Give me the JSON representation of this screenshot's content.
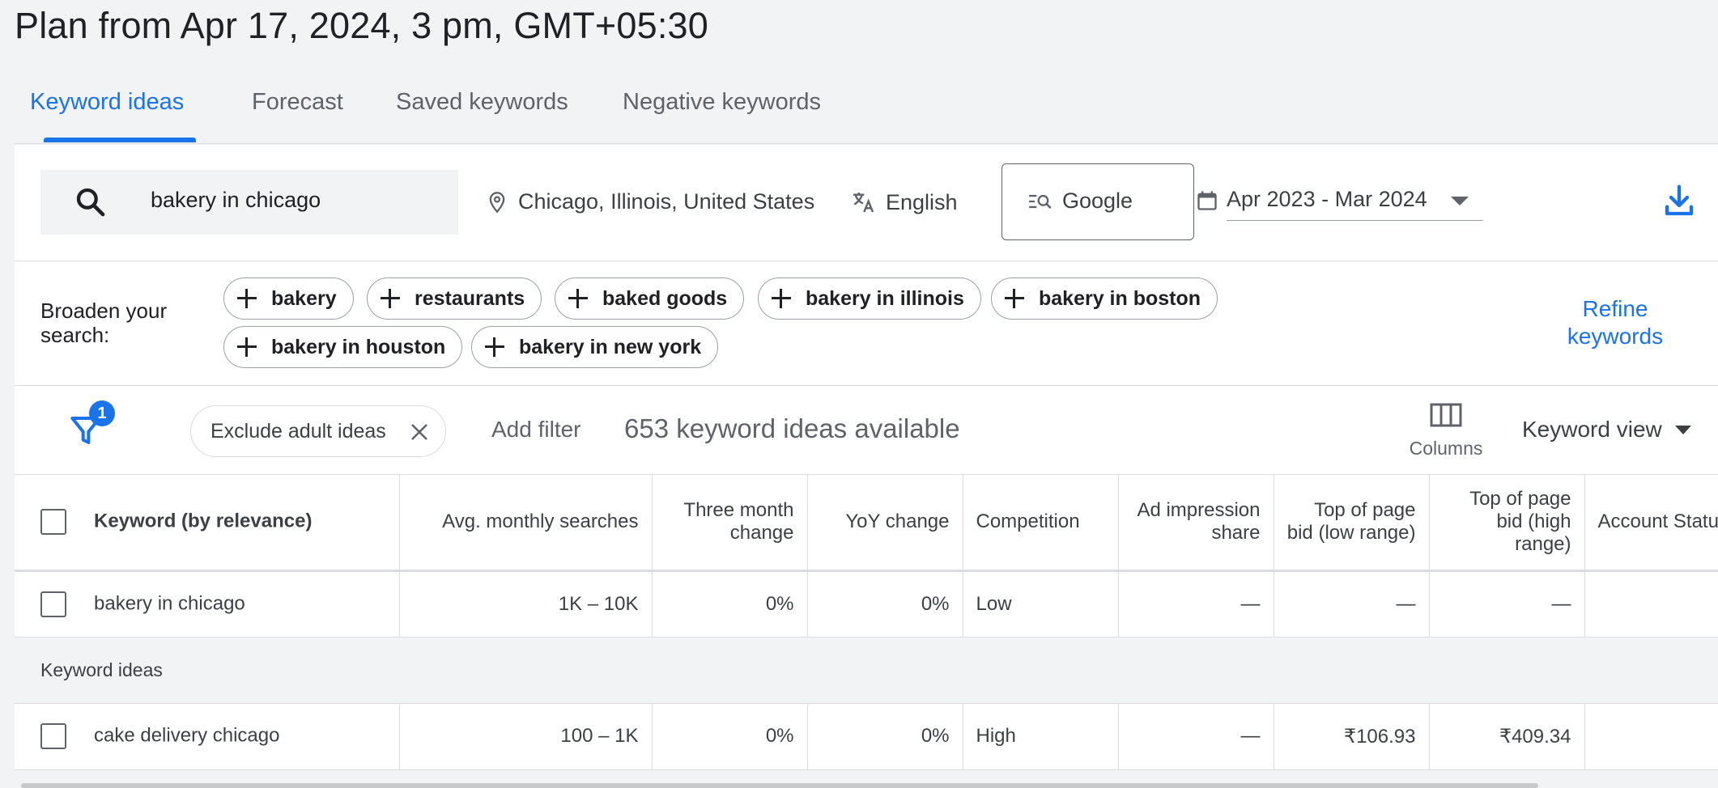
{
  "page_title": "Plan from Apr 17, 2024, 3 pm, GMT+05:30",
  "tabs": [
    {
      "label": "Keyword ideas",
      "active": true
    },
    {
      "label": "Forecast"
    },
    {
      "label": "Saved keywords"
    },
    {
      "label": "Negative keywords"
    }
  ],
  "search": {
    "value": "bakery in chicago"
  },
  "settings": {
    "location": "Chicago, Illinois, United States",
    "language": "English",
    "network": "Google",
    "date_range": "Apr 2023 - Mar 2024"
  },
  "broaden": {
    "label": "Broaden your search:",
    "chips": [
      "bakery",
      "restaurants",
      "baked goods",
      "bakery in illinois",
      "bakery in boston",
      "bakery in houston",
      "bakery in new york"
    ],
    "refine_label": "Refine keywords"
  },
  "filters": {
    "badge_count": "1",
    "active_filter": "Exclude adult ideas",
    "add_filter_label": "Add filter",
    "count_text": "653 keyword ideas available",
    "columns_label": "Columns",
    "view_label": "Keyword view"
  },
  "table": {
    "headers": [
      "Keyword (by relevance)",
      "Avg. monthly searches",
      "Three month change",
      "YoY change",
      "Competition",
      "Ad impression share",
      "Top of page bid (low range)",
      "Top of page bid (high range)",
      "Account Status"
    ],
    "provided_row": {
      "keyword": "bakery in chicago",
      "searches": "1K – 10K",
      "three_month": "0%",
      "yoy": "0%",
      "competition": "Low",
      "impression_share": "—",
      "bid_low": "—",
      "bid_high": "—"
    },
    "group_label": "Keyword ideas",
    "idea_rows": [
      {
        "keyword": "cake delivery chicago",
        "searches": "100 – 1K",
        "three_month": "0%",
        "yoy": "0%",
        "competition": "High",
        "impression_share": "—",
        "bid_low": "₹106.93",
        "bid_high": "₹409.34"
      }
    ]
  },
  "colors": {
    "accent": "#1a73e8",
    "text": "#202124",
    "muted": "#5f6368",
    "background": "#f1f3f4"
  },
  "icons": [
    "search-icon",
    "location-pin-icon",
    "translate-icon",
    "search-network-icon",
    "calendar-icon",
    "download-icon",
    "plus-icon",
    "filter-icon",
    "close-icon",
    "columns-icon",
    "dropdown-caret-icon"
  ]
}
